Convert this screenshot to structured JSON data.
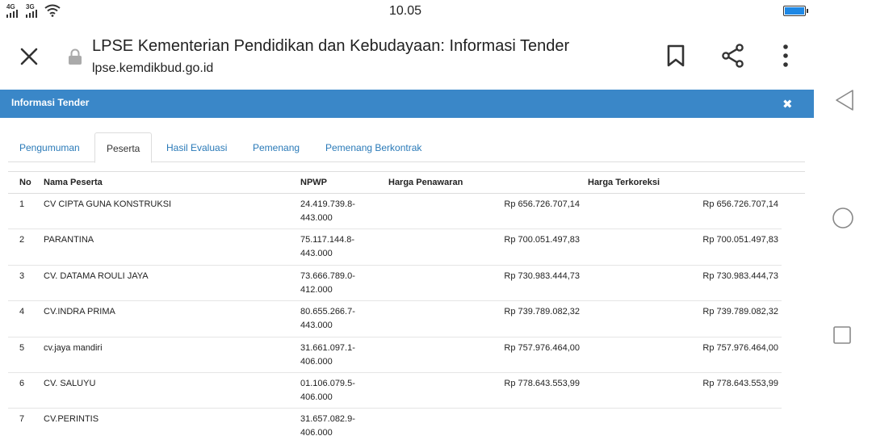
{
  "statusbar": {
    "sim1": "4G",
    "sim2": "3G",
    "time": "10.05"
  },
  "toolbar": {
    "title": "LPSE Kementerian Pendidikan dan Kebudayaan: Informasi Tender",
    "url": "lpse.kemdikbud.go.id"
  },
  "panel": {
    "title": "Informasi Tender",
    "close_label": "✖"
  },
  "tabs": [
    {
      "label": "Pengumuman"
    },
    {
      "label": "Peserta"
    },
    {
      "label": "Hasil Evaluasi"
    },
    {
      "label": "Pemenang"
    },
    {
      "label": "Pemenang Berkontrak"
    }
  ],
  "active_tab": "Peserta",
  "table": {
    "headers": {
      "no": "No",
      "name": "Nama Peserta",
      "npwp": "NPWP",
      "harga": "Harga Penawaran",
      "koreksi": "Harga Terkoreksi"
    },
    "rows": [
      {
        "no": "1",
        "name": "CV CIPTA GUNA KONSTRUKSI",
        "npwp1": "24.419.739.8-",
        "npwp2": "443.000",
        "harga": "Rp 656.726.707,14",
        "koreksi": "Rp 656.726.707,14"
      },
      {
        "no": "2",
        "name": "PARANTINA",
        "npwp1": "75.117.144.8-",
        "npwp2": "443.000",
        "harga": "Rp 700.051.497,83",
        "koreksi": "Rp 700.051.497,83"
      },
      {
        "no": "3",
        "name": "CV. DATAMA ROULI JAYA",
        "npwp1": "73.666.789.0-",
        "npwp2": "412.000",
        "harga": "Rp 730.983.444,73",
        "koreksi": "Rp 730.983.444,73"
      },
      {
        "no": "4",
        "name": "CV.INDRA PRIMA",
        "npwp1": "80.655.266.7-",
        "npwp2": "443.000",
        "harga": "Rp 739.789.082,32",
        "koreksi": "Rp 739.789.082,32"
      },
      {
        "no": "5",
        "name": "cv.jaya mandiri",
        "npwp1": "31.661.097.1-",
        "npwp2": "406.000",
        "harga": "Rp 757.976.464,00",
        "koreksi": "Rp 757.976.464,00"
      },
      {
        "no": "6",
        "name": "CV. SALUYU",
        "npwp1": "01.106.079.5-",
        "npwp2": "406.000",
        "harga": "Rp 778.643.553,99",
        "koreksi": "Rp 778.643.553,99"
      },
      {
        "no": "7",
        "name": "CV.PERINTIS",
        "npwp1": "31.657.082.9-",
        "npwp2": "406.000",
        "harga": "",
        "koreksi": ""
      }
    ]
  },
  "colors": {
    "header_blue": "#3a87c8",
    "tab_link": "#2a7ab8",
    "battery": "#1e88e5"
  },
  "icons": [
    "close-icon",
    "lock-icon",
    "bookmark-icon",
    "share-icon",
    "more-icon",
    "back-icon",
    "home-icon",
    "recents-icon",
    "wifi-icon",
    "battery-icon"
  ]
}
